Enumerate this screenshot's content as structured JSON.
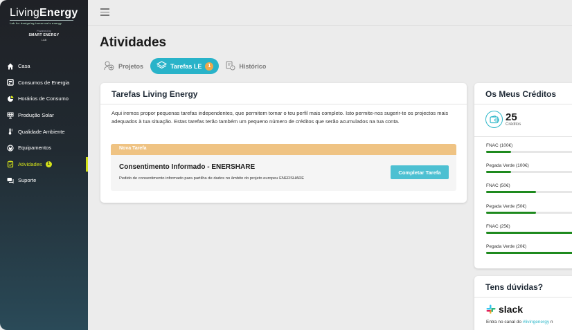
{
  "brand": {
    "logo_thin": "Living",
    "logo_bold": "Energy",
    "tagline": "Lab for designing tomorrow's energy",
    "powered_by": "Powered by",
    "partner": "SMART ENERGY",
    "partner_sub": "LAB"
  },
  "sidebar": {
    "items": [
      {
        "label": "Casa",
        "icon": "home-icon"
      },
      {
        "label": "Consumos de Energia",
        "icon": "meter-icon"
      },
      {
        "label": "Horários de Consumo",
        "icon": "clock-icon"
      },
      {
        "label": "Produção Solar",
        "icon": "solar-panel-icon"
      },
      {
        "label": "Qualidade Ambiente",
        "icon": "thermometer-icon"
      },
      {
        "label": "Equipamentos",
        "icon": "plug-icon"
      },
      {
        "label": "Atividades",
        "icon": "clipboard-icon",
        "badge": "1",
        "active": true
      },
      {
        "label": "Suporte",
        "icon": "chat-icon"
      }
    ]
  },
  "page": {
    "title": "Atividades"
  },
  "tabs": [
    {
      "label": "Projetos",
      "icon": "projects-icon"
    },
    {
      "label": "Tarefas LE",
      "icon": "layers-icon",
      "badge": "1",
      "active": true
    },
    {
      "label": "Histórico",
      "icon": "history-icon"
    }
  ],
  "main_card": {
    "title": "Tarefas Living Energy",
    "description": "Aqui iremos propor pequenas tarefas independentes, que permitem tornar o teu perfil mais completo. Isto permite-nos sugerir-te os projectos mais adequados à tua situação. Estas tarefas terão também um pequeno número de créditos que serão acumulados na tua conta.",
    "task": {
      "header": "Nova Tarefa",
      "title": "Consentimento Informado - ENERSHARE",
      "description": "Pedido de consentimento informado para partilha de dados no âmbito do projeto europeu ENERSHARE",
      "button": "Completar Tarefa"
    }
  },
  "credits": {
    "title": "Os Meus Créditos",
    "total": "25",
    "total_label": "Créditos",
    "items": [
      {
        "name": "FNAC (100€)",
        "progress": 0.25
      },
      {
        "name": "Pegada Verde (100€)",
        "progress": 0.25
      },
      {
        "name": "FNAC (50€)",
        "progress": 0.5
      },
      {
        "name": "Pegada Verde (50€)",
        "progress": 0.5
      },
      {
        "name": "FNAC (25€)",
        "progress": 1.0
      },
      {
        "name": "Pegada Verde (20€)",
        "progress": 1.0
      }
    ]
  },
  "help": {
    "title": "Tens dúvidas?",
    "slack": "slack",
    "text_prefix": "Entra no canal do ",
    "channel": "#livingenergy",
    "text_suffix": " n"
  },
  "colors": {
    "accent": "#29b3c9",
    "active_nav": "#d4e21a",
    "task_header": "#efc383",
    "progress": "#1e8a1e"
  }
}
